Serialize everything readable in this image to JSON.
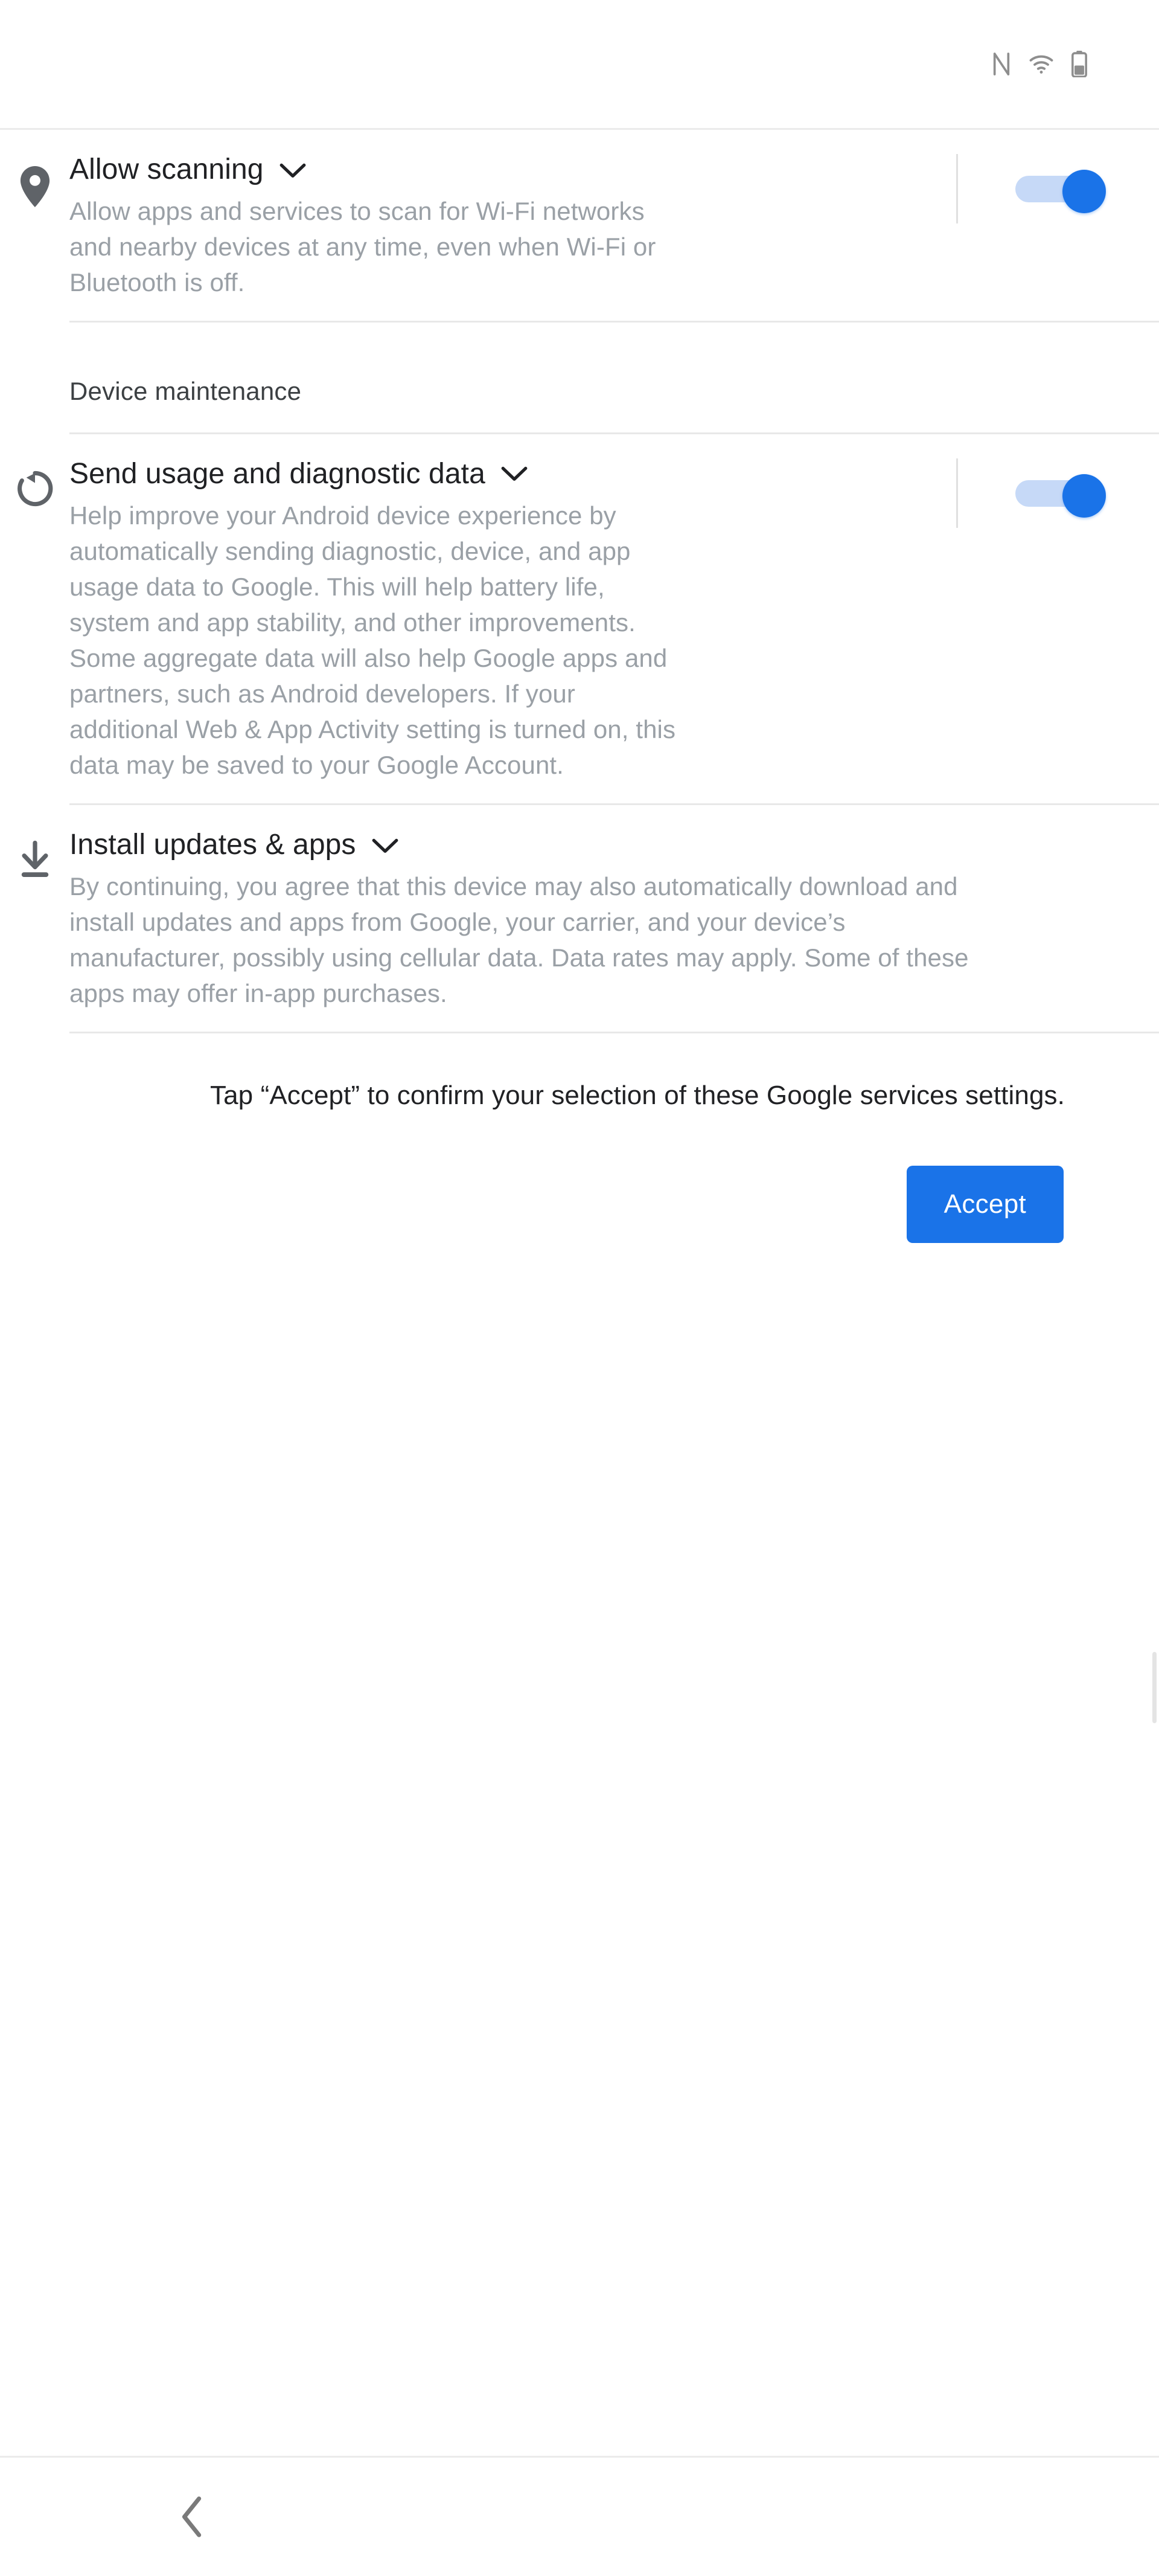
{
  "status_bar": {
    "icons": [
      "nfc-icon",
      "wifi-icon",
      "battery-icon"
    ]
  },
  "settings": {
    "allow_scanning": {
      "icon": "location-pin-icon",
      "title": "Allow scanning",
      "expander": "chevron-down-icon",
      "description": "Allow apps and services to scan for Wi-Fi networks and nearby devices at any time, even when Wi-Fi or Bluetooth is off.",
      "toggle_state": "on"
    },
    "device_maintenance_header": "Device maintenance",
    "usage_diagnostics": {
      "icon": "sync-refresh-icon",
      "title": "Send usage and diagnostic data",
      "expander": "chevron-down-icon",
      "description": "Help improve your Android device experience by automatically sending diagnostic, device, and app usage data to Google. This will help battery life, system and app stability, and other improvements. Some aggregate data will also help Google apps and partners, such as Android developers. If your additional Web & App Activity setting is turned on, this data may be saved to your Google Account.",
      "toggle_state": "on"
    },
    "install_updates": {
      "icon": "download-icon",
      "title": "Install updates & apps",
      "expander": "chevron-down-icon",
      "description": "By continuing, you agree that this device may also automatically download and install updates and apps from Google, your carrier, and your device’s manufacturer, possibly using cellular data. Data rates may apply. Some of these apps may offer in-app purchases."
    }
  },
  "footer": {
    "note": "Tap “Accept” to confirm your selection of these Google services settings.",
    "accept_label": "Accept"
  },
  "nav_bar": {
    "back": "back-chevron-icon"
  },
  "colors": {
    "accent": "#1a73e8",
    "track": "#c6d9f7",
    "title": "#202124",
    "body": "#9aa0a6",
    "divider": "#e8e8e8"
  }
}
